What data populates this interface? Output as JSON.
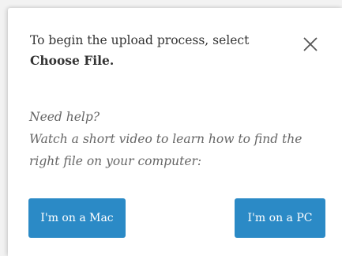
{
  "popover": {
    "instruction_prefix": "To begin the upload process, select",
    "instruction_action": "Choose File.",
    "close_icon": "close-icon",
    "help_heading": "Need help?",
    "help_text": "Watch a short video to learn how to find the right file on your computer:",
    "mac_button_label": "I'm on a Mac",
    "pc_button_label": "I'm on a PC",
    "button_color": "#2b8ac6"
  }
}
